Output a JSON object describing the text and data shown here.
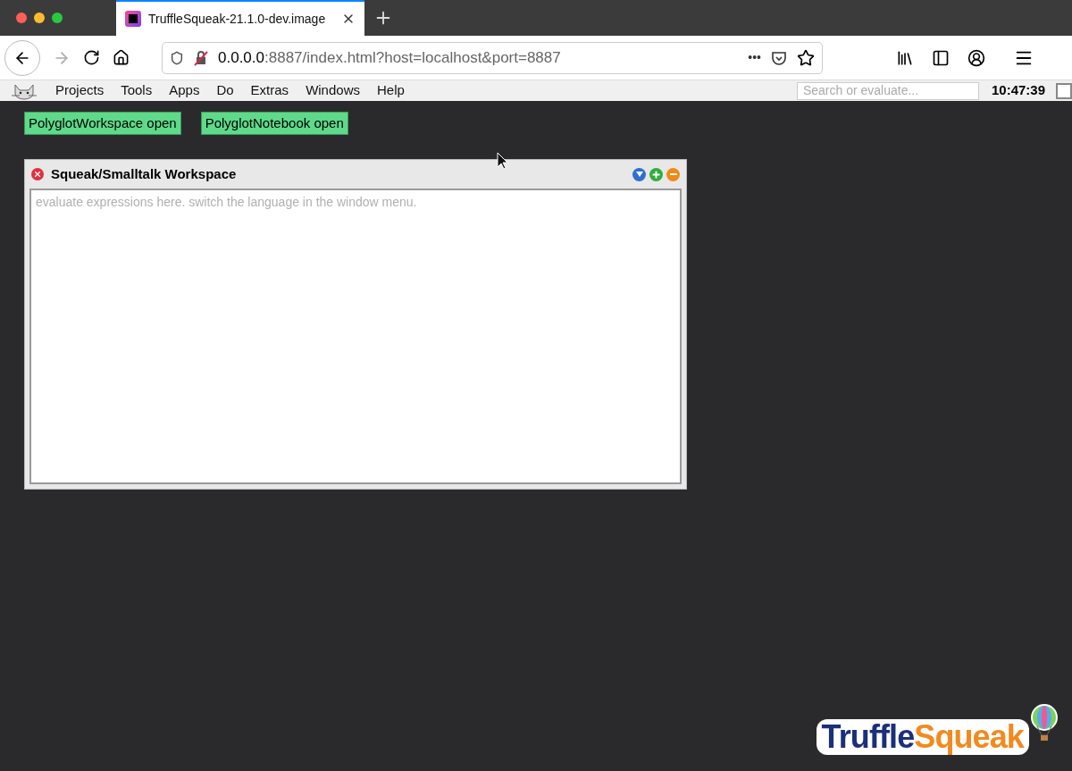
{
  "browser": {
    "tab_title": "TruffleSqueak-21.1.0-dev.image",
    "url_host": "0.0.0.0",
    "url_rest": ":8887/index.html?host=localhost&port=8887",
    "url_actions": "•••"
  },
  "menu_bar": {
    "items": [
      "Projects",
      "Tools",
      "Apps",
      "Do",
      "Extras",
      "Windows",
      "Help"
    ],
    "search": {
      "placeholder": "Search or evaluate..."
    },
    "clock": "10:47:39"
  },
  "desktop_buttons": [
    "PolyglotWorkspace open",
    "PolyglotNotebook open"
  ],
  "workspace": {
    "title": "Squeak/Smalltalk Workspace",
    "placeholder": "evaluate expressions here. switch the language in the window menu."
  },
  "logo": {
    "parts": [
      {
        "text": "Truffle",
        "color": "#1b2f7a"
      },
      {
        "text": "Squeak",
        "color": "#f28a1e"
      }
    ]
  }
}
